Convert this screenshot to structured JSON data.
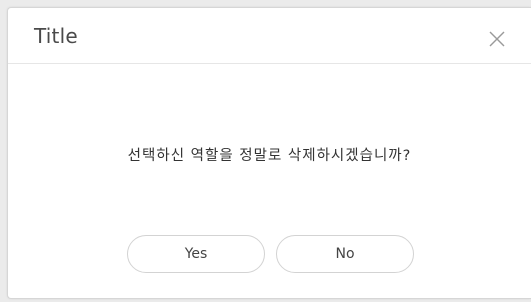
{
  "dialog": {
    "title": "Title",
    "close_icon": "close-icon",
    "message": "선택하신 역할을 정말로 삭제하시겠습니까?",
    "buttons": {
      "yes_label": "Yes",
      "no_label": "No"
    }
  },
  "colors": {
    "backdrop": "#ebebeb",
    "dialog_bg": "#ffffff",
    "border": "#d6d6d6",
    "title_text": "#4a4a4a",
    "body_text": "#333333",
    "button_border": "#d3d3d3"
  }
}
